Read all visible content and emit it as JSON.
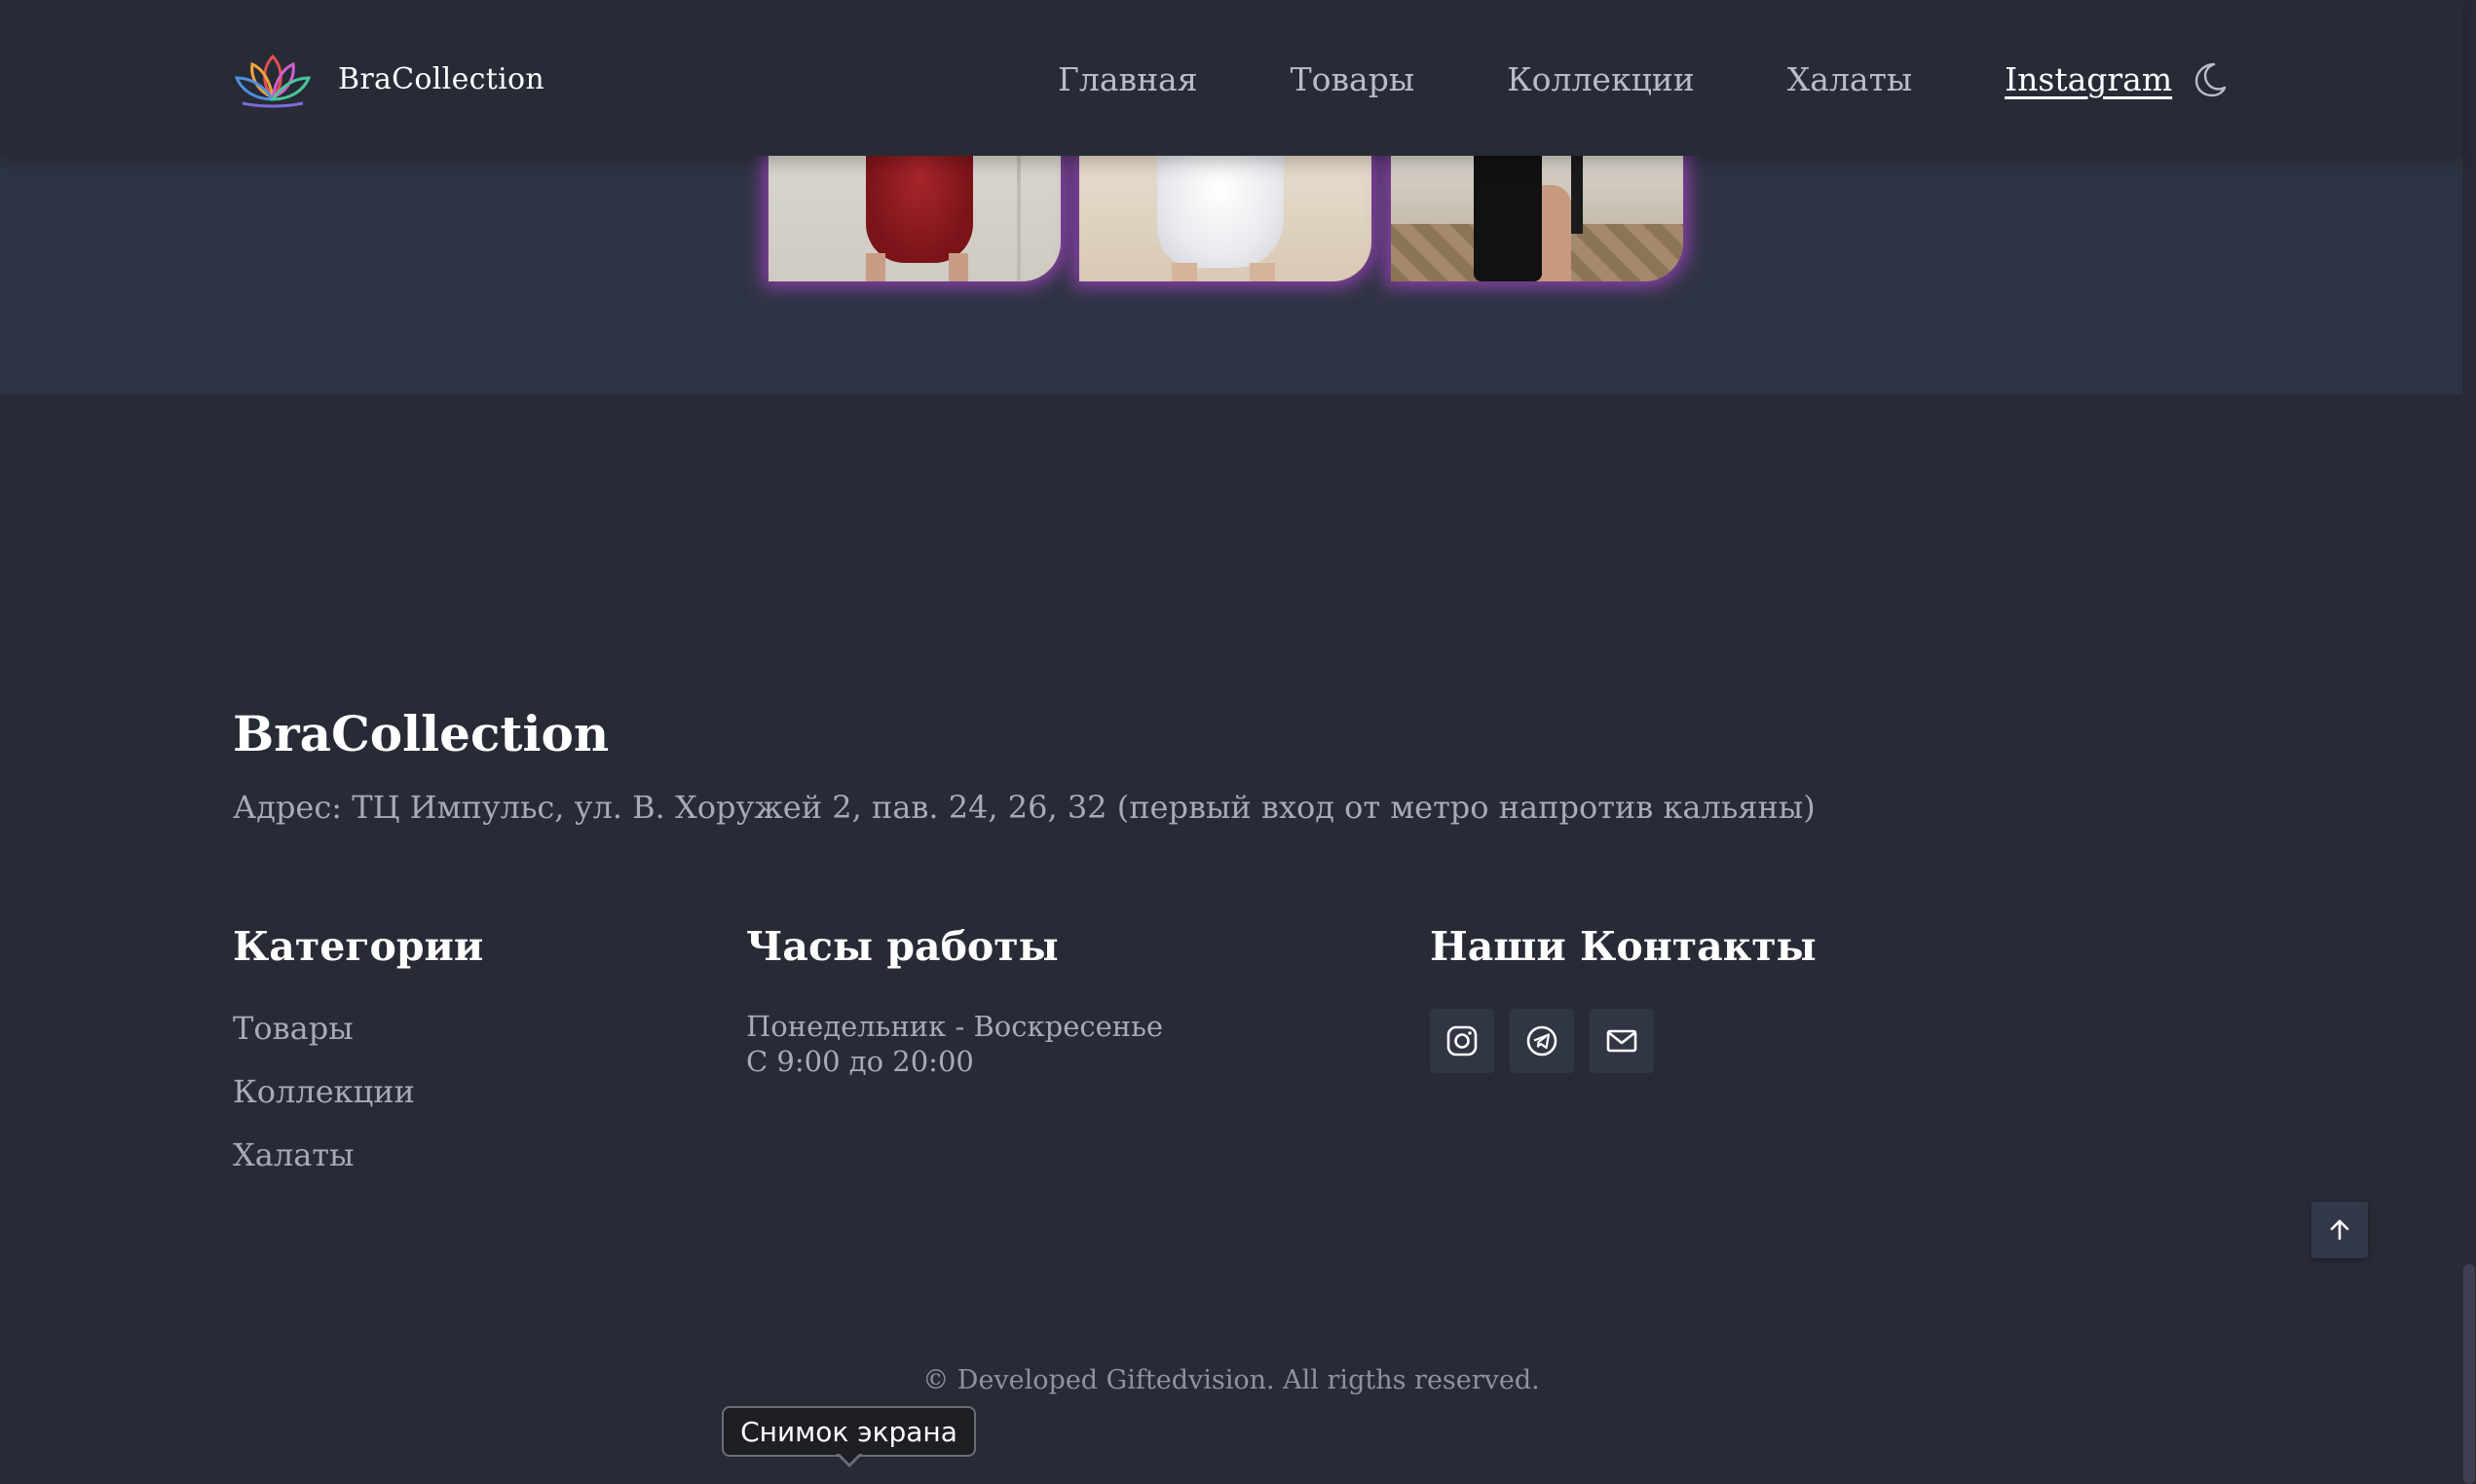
{
  "header": {
    "brand_name": "BraCollection",
    "nav": [
      {
        "label": "Главная"
      },
      {
        "label": "Товары"
      },
      {
        "label": "Коллекции"
      },
      {
        "label": "Халаты"
      },
      {
        "label": "Instagram",
        "active": true
      }
    ],
    "theme_toggle_icon": "moon-icon"
  },
  "gallery": {
    "photos": [
      {
        "icon": "product-photo-red-robe"
      },
      {
        "icon": "product-photo-white-robe"
      },
      {
        "icon": "product-photo-black-robe"
      }
    ],
    "glow_color": "#a846c8"
  },
  "footer": {
    "brand": "BraCollection",
    "address": "Адрес: ТЦ Импульс, ул. В. Хоружей 2, пав. 24, 26, 32 (первый вход от метро напротив кальяны)",
    "categories": {
      "title": "Категории",
      "links": [
        "Товары",
        "Коллекции",
        "Халаты"
      ]
    },
    "hours": {
      "title": "Часы работы",
      "days": "Понедельник - Воскресенье",
      "time": "С 9:00 до 20:00"
    },
    "contacts": {
      "title": "Наши Контакты",
      "icons": [
        "instagram-icon",
        "telegram-icon",
        "mail-icon"
      ]
    },
    "copyright": "© Developed Giftedvision. All rigths reserved."
  },
  "scroll_top_icon": "arrow-up-icon",
  "tooltip": {
    "label": "Снимок экрана"
  },
  "colors": {
    "background": "#272b36",
    "band": "#2f3444",
    "text_muted": "#a7abb7",
    "text_white": "#ffffff"
  }
}
